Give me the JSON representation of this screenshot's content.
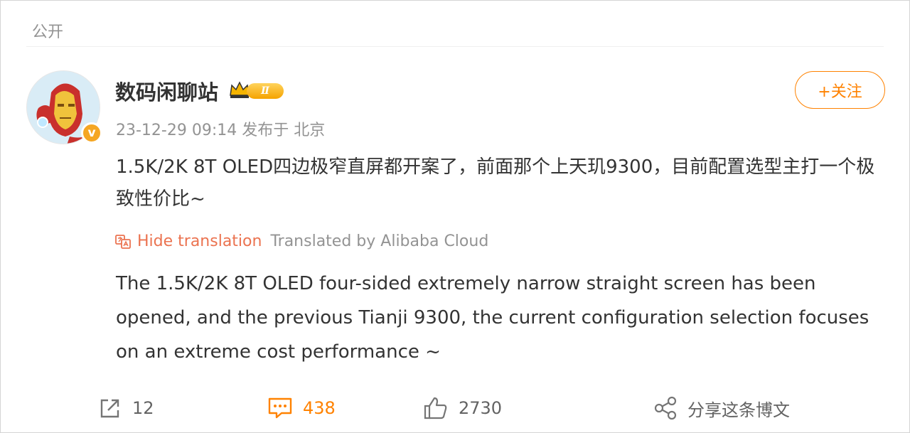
{
  "visibility": "公开",
  "post": {
    "username": "数码闲聊站",
    "level_badge": "Ⅱ",
    "verify_mark": "v",
    "timestamp": "23-12-29 09:14",
    "source": "发布于 北京",
    "text": "1.5K/2K 8T OLED四边极窄直屏都开案了，前面那个上天玑9300，目前配置选型主打一个极致性价比~",
    "follow_label": "+关注"
  },
  "translation": {
    "hide_label": "Hide translation",
    "provider": "Translated by Alibaba Cloud",
    "text": "The 1.5K/2K 8T OLED four-sided extremely narrow straight screen has been opened, and the previous Tianji 9300, the current configuration selection focuses on an extreme cost performance ~"
  },
  "actions": {
    "repost_count": "12",
    "comment_count": "438",
    "like_count": "2730",
    "share_label": "分享这条博文"
  },
  "colors": {
    "accent": "#ff8200",
    "translate_link": "#eb7350",
    "muted": "#939393"
  }
}
